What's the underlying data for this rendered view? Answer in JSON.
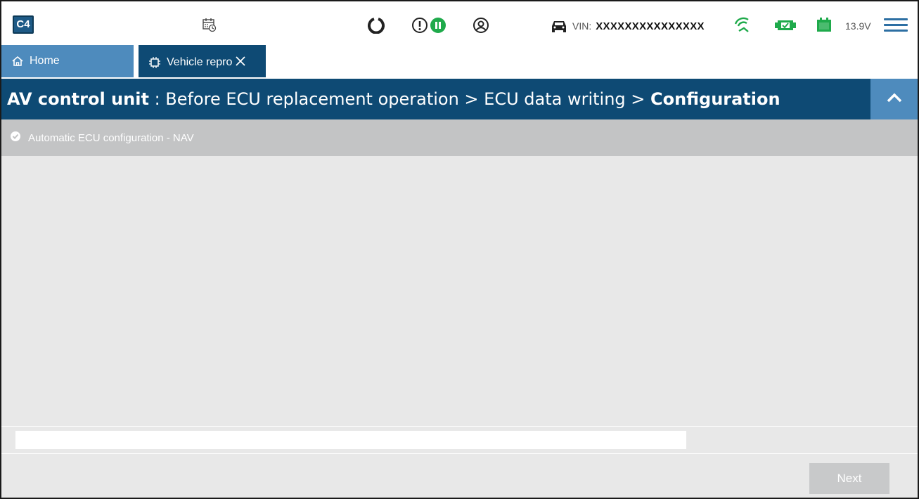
{
  "app": {
    "logo_text": "C4"
  },
  "topbar": {
    "icons": [
      "calendar-clock-icon",
      "refresh-icon",
      "alert-icon",
      "pause-icon",
      "user-icon",
      "car-icon",
      "wireless-icon",
      "connection-icon",
      "battery-icon",
      "menu-icon"
    ],
    "vin_label": "VIN:",
    "vin_value": "XXXXXXXXXXXXXXX",
    "voltage": "13.9V",
    "colors": {
      "accent": "#2d6fa3",
      "status_green": "#1faa4b"
    }
  },
  "tabs": [
    {
      "label": "Home",
      "icon": "home-icon"
    },
    {
      "label": "Vehicle repro",
      "icon": "chip-icon",
      "closable": true
    }
  ],
  "breadcrumb": {
    "unit": "AV control unit",
    "separator": " : ",
    "path": "Before ECU replacement operation > ECU data writing > ",
    "current": "Configuration"
  },
  "status": {
    "label": "Automatic ECU configuration - NAV",
    "icon": "check-circle-icon"
  },
  "progress": {
    "value_percent": 0
  },
  "footer": {
    "next_label": "Next",
    "next_enabled": false
  }
}
